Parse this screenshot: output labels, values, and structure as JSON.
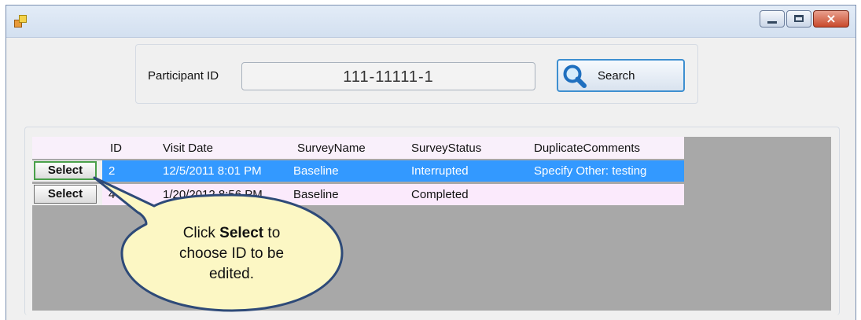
{
  "window": {
    "icon": "app-window-icon",
    "controls": {
      "minimize": "minimize-icon",
      "maximize": "maximize-icon",
      "close": "×"
    }
  },
  "search": {
    "label": "Participant ID",
    "value": "111-11111-1",
    "button_label": "Search",
    "button_icon": "magnifier-icon"
  },
  "grid": {
    "columns": [
      "",
      "ID",
      "Visit Date",
      "SurveyName",
      "SurveyStatus",
      "DuplicateComments"
    ],
    "rows": [
      {
        "action": "Select",
        "id": "2",
        "visit_date": "12/5/2011 8:01 PM",
        "survey_name": "Baseline",
        "survey_status": "Interrupted",
        "comments": "Specify Other: testing",
        "selected": true
      },
      {
        "action": "Select",
        "id": "4",
        "visit_date": "1/20/2012 8:56 PM",
        "survey_name": "Baseline",
        "survey_status": "Completed",
        "comments": "",
        "selected": false
      }
    ]
  },
  "callout": {
    "prefix": "Click ",
    "emphasis": "Select",
    "suffix": " to choose ID to be edited.",
    "line1_pre": "Click",
    "line1_bold": "Select",
    "line1_post": "to",
    "line2": "choose ID to be",
    "line3": "edited."
  },
  "colors": {
    "selected_row": "#3399ff",
    "alt_row": "#fbeafc",
    "grid_bg": "#a8a8a8",
    "callout_fill": "#fcf7c4",
    "callout_border": "#2e4a78"
  }
}
